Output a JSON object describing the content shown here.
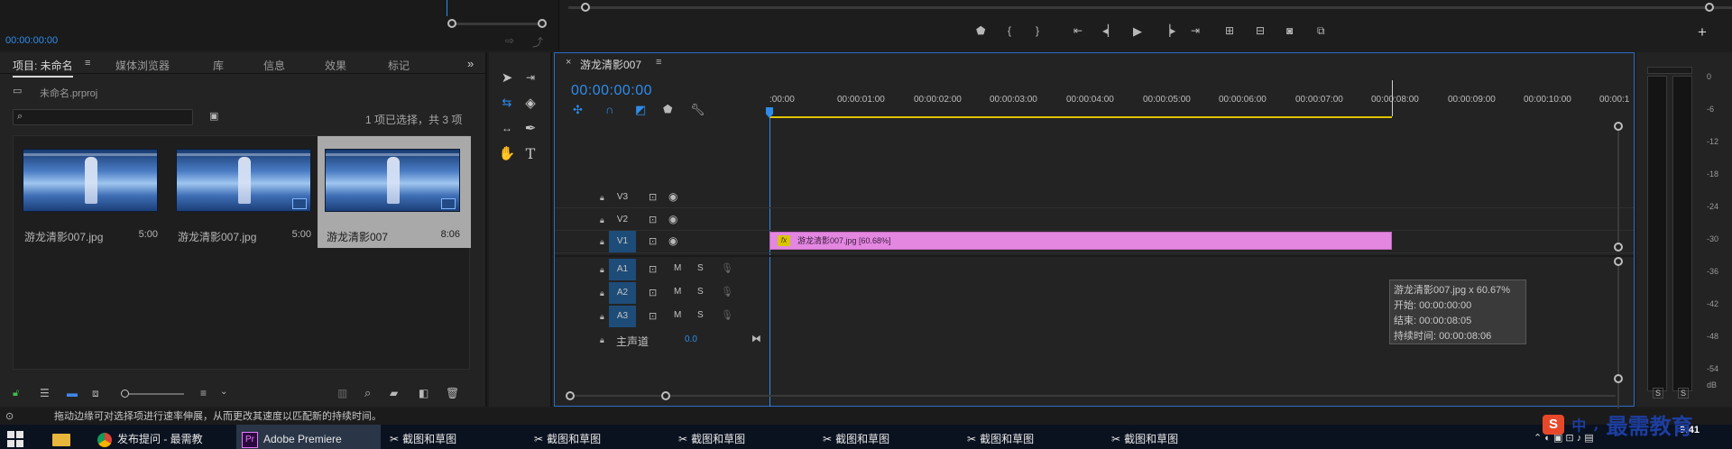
{
  "source_monitor": {
    "timecode": "00:00:00:00"
  },
  "project": {
    "tabs": [
      {
        "label": "项目: 未命名"
      },
      {
        "label": "媒体浏览器"
      },
      {
        "label": "库"
      },
      {
        "label": "信息"
      },
      {
        "label": "效果"
      },
      {
        "label": "标记"
      }
    ],
    "file": "未命名.prproj",
    "search_placeholder": "",
    "selection_info": "1 项已选择，共 3 项",
    "items": [
      {
        "name": "游龙清影007.jpg",
        "duration": "5:00"
      },
      {
        "name": "游龙清影007.jpg",
        "duration": "5:00"
      },
      {
        "name": "游龙清影007",
        "duration": "8:06"
      }
    ]
  },
  "timeline": {
    "sequence_name": "游龙清影007",
    "timecode": "00:00:00:00",
    "ruler": [
      ":00:00",
      "00:00:01:00",
      "00:00:02:00",
      "00:00:03:00",
      "00:00:04:00",
      "00:00:05:00",
      "00:00:06:00",
      "00:00:07:00",
      "00:00:08:00",
      "00:00:09:00",
      "00:00:10:00",
      "00:00:1"
    ],
    "video_tracks": [
      "V3",
      "V2",
      "V1"
    ],
    "audio_tracks": [
      "A1",
      "A2",
      "A3"
    ],
    "mute_label": "M",
    "solo_label": "S",
    "master_label": "主声道",
    "master_value": "0.0",
    "clip_label": "游龙清影007.jpg [60.68%]",
    "clip_fx": "fx",
    "tooltip": {
      "line1": "游龙清影007.jpg x 60.67%",
      "line2": "开始: 00:00:00:00",
      "line3": "结束: 00:00:08:05",
      "line4": "持续时间: 00:00:08:06"
    }
  },
  "meters": {
    "scale": [
      "0",
      "-6",
      "-12",
      "-18",
      "-24",
      "-30",
      "-36",
      "-42",
      "-48",
      "-54",
      "dB"
    ],
    "solo_left": "S",
    "solo_right": "S"
  },
  "status_text": "拖动边缘可对选择项进行速率伸展，从而更改其速度以匹配新的持续时间。",
  "taskbar": {
    "items": [
      {
        "label": ""
      },
      {
        "label": ""
      },
      {
        "label": "发布提问 - 最需教"
      },
      {
        "label": "Adobe Premiere"
      },
      {
        "label": "截图和草图"
      },
      {
        "label": "截图和草图"
      },
      {
        "label": "截图和草图"
      },
      {
        "label": "截图和草图"
      },
      {
        "label": "截图和草图"
      },
      {
        "label": "截图和草图"
      }
    ],
    "time": "9:41",
    "ime": "中",
    "brand": "最需教育"
  },
  "colors": {
    "accent": "#2d8ceb",
    "clip": "#e387e1",
    "work_area": "#e3c200"
  }
}
